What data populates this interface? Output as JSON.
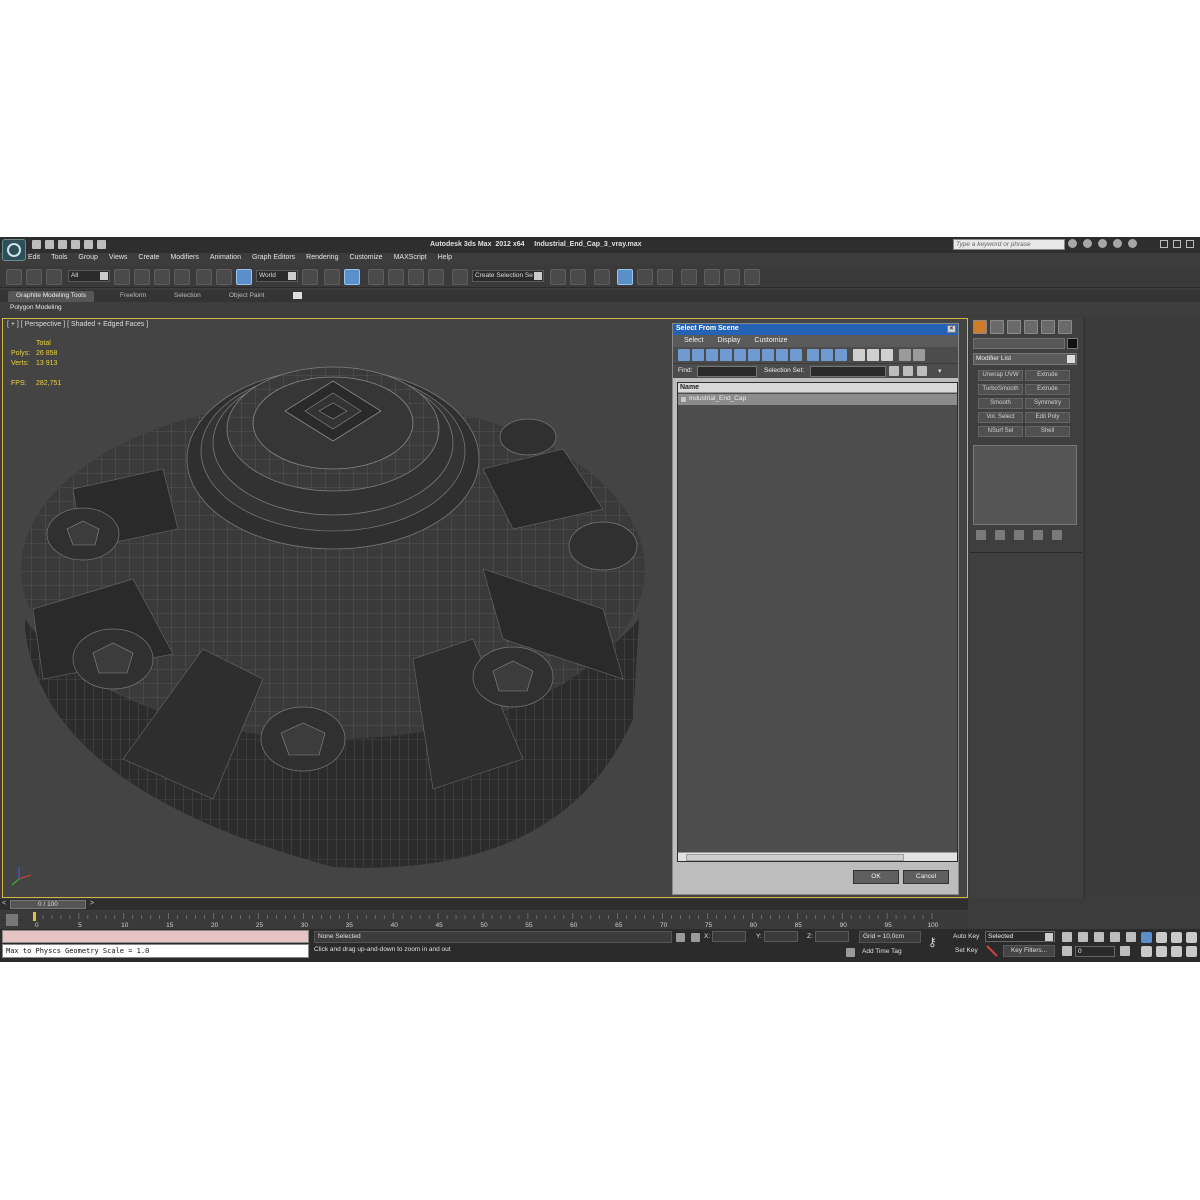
{
  "window": {
    "title": "Autodesk 3ds Max  2012 x64     Industrial_End_Cap_3_vray.max",
    "search_placeholder": "Type a keyword or phrase"
  },
  "menu": [
    "Edit",
    "Tools",
    "Group",
    "Views",
    "Create",
    "Modifiers",
    "Animation",
    "Graph Editors",
    "Rendering",
    "Customize",
    "MAXScript",
    "Help"
  ],
  "toolbar": {
    "selection_filter": "All",
    "reference_coord": "World",
    "named_selection": "Create Selection Se"
  },
  "ribbon": {
    "tabs": [
      "Graphite Modeling Tools",
      "Freeform",
      "Selection",
      "Object Paint"
    ],
    "panel": "Polygon Modeling"
  },
  "viewport": {
    "label": "[ + ] [ Perspective ] [ Shaded + Edged Faces ]",
    "stats_header": "Total",
    "polys_label": "Polys:",
    "polys_value": "26 858",
    "verts_label": "Verts:",
    "verts_value": "13 913",
    "fps_label": "FPS:",
    "fps_value": "282,751"
  },
  "dialog": {
    "title": "Select From Scene",
    "menu": [
      "Select",
      "Display",
      "Customize"
    ],
    "find_label": "Find:",
    "selection_set_label": "Selection Set:",
    "column_name": "Name",
    "items": [
      "Industrial_End_Cap"
    ],
    "ok": "OK",
    "cancel": "Cancel"
  },
  "command_panel": {
    "modifier_list": "Modifier List",
    "modifier_buttons": [
      "Unwrap UVW",
      "Extrude",
      "TurboSmooth",
      "Extrude",
      "Smooth",
      "Symmetry",
      "Vol. Select",
      "Edit Poly",
      "NSurf Sel",
      "Shell"
    ]
  },
  "timeline": {
    "frame_display": "0 / 100",
    "prev": "<",
    "next": ">",
    "ticks": [
      "0",
      "5",
      "10",
      "15",
      "20",
      "25",
      "30",
      "35",
      "40",
      "45",
      "50",
      "55",
      "60",
      "65",
      "70",
      "75",
      "80",
      "85",
      "90",
      "95",
      "100"
    ]
  },
  "status": {
    "listener_output": "Max to Physcs Geometry Scale = 1.0",
    "selection": "None Selected",
    "prompt": "Click and drag up-and-down to zoom in and out",
    "x_label": "X:",
    "y_label": "Y:",
    "z_label": "Z:",
    "grid": "Grid = 10,0cm",
    "add_time_tag": "Add Time Tag",
    "auto_key": "Auto Key",
    "set_key": "Set Key",
    "key_mode": "Selected",
    "key_filters": "Key Filters...",
    "frame": "0"
  },
  "colors": {
    "viewport_border": "#d6b840",
    "stats_text": "#e9d23a",
    "dialog_title": "#2462b5",
    "active_button": "#5a8fc9"
  }
}
